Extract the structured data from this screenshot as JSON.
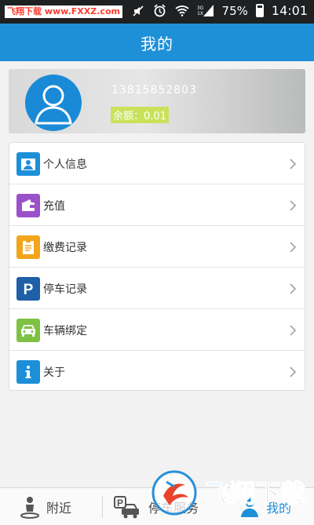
{
  "statusbar": {
    "watermark": "飞翔下载 www.FXXZ.com",
    "network": "3G",
    "network_sub": "1X",
    "battery": "75%",
    "time": "14:01"
  },
  "header": {
    "title": "我的"
  },
  "profile": {
    "phone": "13815852803",
    "balance_label": "余额：",
    "balance_value": "0.01"
  },
  "menu": {
    "items": [
      {
        "label": "个人信息",
        "icon": "person-card-icon",
        "color": "#1d8fd9"
      },
      {
        "label": "充值",
        "icon": "wallet-icon",
        "color": "#9b51c9"
      },
      {
        "label": "缴费记录",
        "icon": "clipboard-icon",
        "color": "#f2a51a"
      },
      {
        "label": "停车记录",
        "icon": "parking-icon",
        "color": "#1f5fa8"
      },
      {
        "label": "车辆绑定",
        "icon": "car-icon",
        "color": "#7dc243"
      },
      {
        "label": "关于",
        "icon": "info-icon",
        "color": "#1d8fd9"
      }
    ]
  },
  "tabbar": {
    "tabs": [
      {
        "label": "附近",
        "icon": "location-person-icon"
      },
      {
        "label": "停车服务",
        "icon": "parking-car-icon"
      },
      {
        "label": "我的",
        "icon": "user-icon"
      }
    ]
  },
  "logo_watermark": {
    "text": "飞翔下载"
  }
}
